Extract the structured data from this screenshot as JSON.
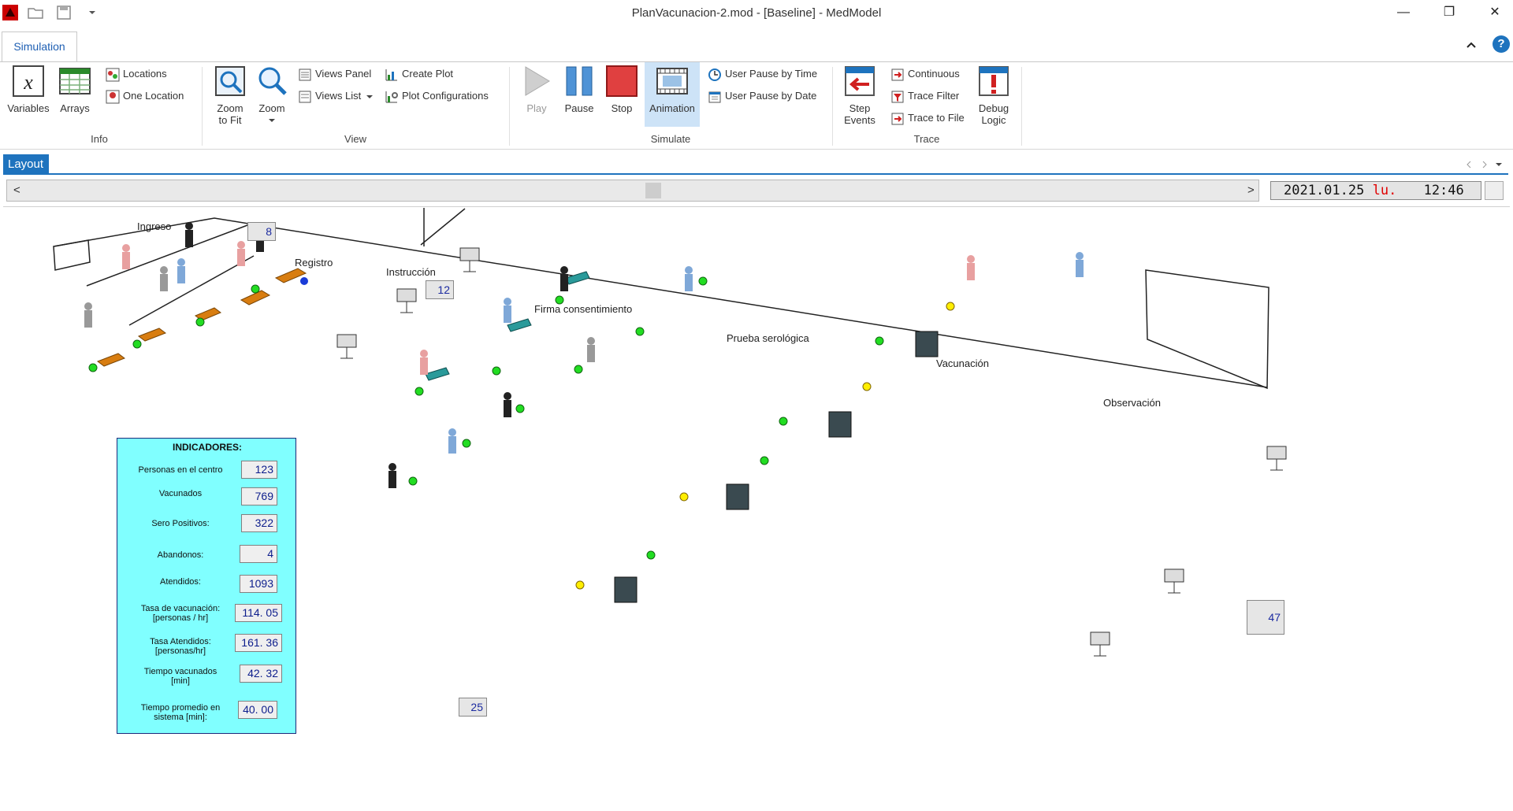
{
  "window": {
    "title": "PlanVacunacion-2.mod - [Baseline] - MedModel",
    "minimize": "—",
    "restore": "❐",
    "close": "✕",
    "help": "?"
  },
  "tabs": {
    "simulation": "Simulation"
  },
  "ribbon": {
    "info": {
      "label": "Info",
      "variables": "Variables",
      "arrays": "Arrays",
      "locations": "Locations",
      "one_location": "One Location"
    },
    "view": {
      "label": "View",
      "zoom_to_fit_1": "Zoom",
      "zoom_to_fit_2": "to Fit",
      "zoom": "Zoom",
      "views_panel": "Views Panel",
      "views_list": "Views List",
      "create_plot": "Create Plot",
      "plot_configurations": "Plot Configurations"
    },
    "simulate": {
      "label": "Simulate",
      "play": "Play",
      "pause": "Pause",
      "stop": "Stop",
      "animation": "Animation",
      "user_pause_time": "User Pause by Time",
      "user_pause_date": "User Pause by Date"
    },
    "trace": {
      "label": "Trace",
      "step_events_1": "Step",
      "step_events_2": "Events",
      "continuous": "Continuous",
      "trace_filter": "Trace Filter",
      "trace_to_file": "Trace to File",
      "debug_logic_1": "Debug",
      "debug_logic_2": "Logic"
    }
  },
  "layout_tab": "Layout",
  "scroll": {
    "left": "<",
    "right": ">"
  },
  "clock": {
    "date": "2021.01.25",
    "dow": "lu.",
    "time": "12:46"
  },
  "areas": {
    "ingreso": "Ingreso",
    "registro": "Registro",
    "instruccion": "Instrucción",
    "firma": "Firma consentimiento",
    "prueba": "Prueba serológica",
    "vacunacion": "Vacunación",
    "observacion": "Observación"
  },
  "counters": {
    "ingreso": "8",
    "instruccion": "12",
    "bottom": "25",
    "observacion": "47"
  },
  "indicators": {
    "title": "INDICADORES:",
    "rows": [
      {
        "label": "Personas en el centro",
        "value": "123"
      },
      {
        "label": "Vacunados",
        "value": "769"
      },
      {
        "label": "Sero Positivos:",
        "value": "322"
      },
      {
        "label": "Abandonos:",
        "value": "4"
      },
      {
        "label": "Atendidos:",
        "value": "1093"
      },
      {
        "label": "Tasa de vacunación:\n[personas / hr]",
        "value": "114. 05"
      },
      {
        "label": "Tasa Atendidos:\n[personas/hr]",
        "value": "161. 36"
      },
      {
        "label": "Tiempo vacunados\n[min]",
        "value": "42. 32"
      },
      {
        "label": "Tiempo promedio en\nsistema [min]:",
        "value": "40. 00"
      }
    ]
  },
  "colors": {
    "accent": "#1e73be",
    "indicator_bg": "#80ffff",
    "stop_red": "#e04040",
    "status_green": "#22dd22",
    "status_yellow": "#ffee00"
  }
}
